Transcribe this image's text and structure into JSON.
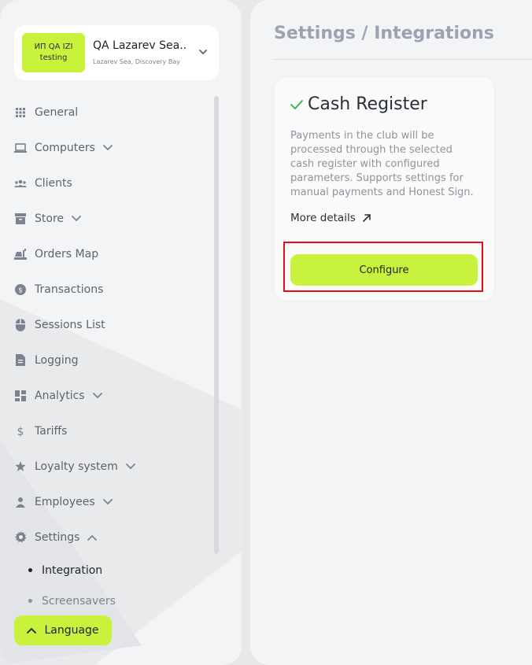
{
  "org": {
    "logo_line1": "ИП QA IZI",
    "logo_line2": "testing",
    "name": "QA Lazarev Sea...",
    "location": "Lazarev Sea, Discovery Bay"
  },
  "nav": {
    "items": [
      {
        "label": "General",
        "icon": "grid-icon"
      },
      {
        "label": "Computers",
        "icon": "laptop-icon",
        "expandable": true
      },
      {
        "label": "Clients",
        "icon": "users-icon"
      },
      {
        "label": "Store",
        "icon": "box-icon",
        "expandable": true
      },
      {
        "label": "Orders Map",
        "icon": "food-icon"
      },
      {
        "label": "Transactions",
        "icon": "dollar-coin-icon"
      },
      {
        "label": "Sessions List",
        "icon": "mouse-icon"
      },
      {
        "label": "Logging",
        "icon": "document-icon"
      },
      {
        "label": "Analytics",
        "icon": "dashboard-icon",
        "expandable": true
      },
      {
        "label": "Tariffs",
        "icon": "dollar-icon"
      },
      {
        "label": "Loyalty system",
        "icon": "star-icon",
        "expandable": true
      },
      {
        "label": "Employees",
        "icon": "person-icon",
        "expandable": true
      },
      {
        "label": "Settings",
        "icon": "gear-icon",
        "expanded": true
      }
    ],
    "settings_sub": [
      {
        "label": "Integration",
        "active": true
      },
      {
        "label": "Screensavers",
        "active": false
      }
    ]
  },
  "language_button": "Language",
  "main": {
    "title": "Settings / Integrations",
    "card": {
      "title": "Cash Register",
      "description": "Payments in the club will be processed through the selected cash register with configured parameters. Supports settings for manual payments and Honest Sign.",
      "more_details": "More details",
      "configure": "Configure"
    }
  },
  "colors": {
    "accent": "#c8f23c",
    "check": "#2fb24c",
    "highlight": "#e3101b"
  }
}
